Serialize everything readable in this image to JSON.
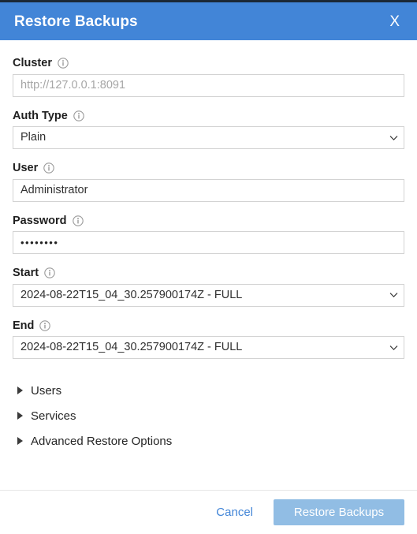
{
  "theme": {
    "header_blue": "#4285d7",
    "top_strip": "#1b2836",
    "link_blue": "#4285d7",
    "primary_button_bg": "#91bde4",
    "input_border": "#d3d3d3",
    "placeholder_color": "#a6a6a6"
  },
  "header": {
    "title": "Restore Backups",
    "close_label": "X",
    "close_icon": "close-x-icon"
  },
  "form": {
    "cluster": {
      "label": "Cluster",
      "info_icon": "info-circle-icon",
      "value": "",
      "placeholder": "http://127.0.0.1:8091"
    },
    "auth_type": {
      "label": "Auth Type",
      "info_icon": "info-circle-icon",
      "value": "Plain",
      "chevron_icon": "chevron-down-icon"
    },
    "user": {
      "label": "User",
      "info_icon": "info-circle-icon",
      "value": "Administrator",
      "placeholder": ""
    },
    "password": {
      "label": "Password",
      "info_icon": "info-circle-icon",
      "value": "••••••••",
      "placeholder": ""
    },
    "start": {
      "label": "Start",
      "info_icon": "info-circle-icon",
      "value": "2024-08-22T15_04_30.257900174Z - FULL",
      "chevron_icon": "chevron-down-icon"
    },
    "end": {
      "label": "End",
      "info_icon": "info-circle-icon",
      "value": "2024-08-22T15_04_30.257900174Z - FULL",
      "chevron_icon": "chevron-down-icon"
    }
  },
  "sections": [
    {
      "label": "Users",
      "expanded": false,
      "toggle_icon": "triangle-right-icon"
    },
    {
      "label": "Services",
      "expanded": false,
      "toggle_icon": "triangle-right-icon"
    },
    {
      "label": "Advanced Restore Options",
      "expanded": false,
      "toggle_icon": "triangle-right-icon"
    }
  ],
  "footer": {
    "cancel_label": "Cancel",
    "submit_label": "Restore Backups"
  }
}
